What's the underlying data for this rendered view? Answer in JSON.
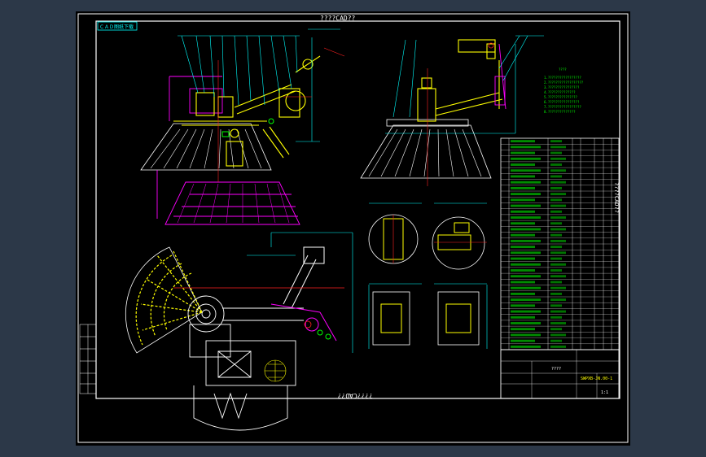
{
  "drawing": {
    "title_top": "????CAD??",
    "title_bottom": "????CAD??",
    "title_side": "????CAD??",
    "stamp": "ＣＡＤ图纸下载",
    "block_name": "????",
    "block_code": "SWPXB-JN.00-1",
    "block_scale": "1:1"
  },
  "colors": {
    "background": "#000000",
    "frame": "#ffffff",
    "magenta": "#ff00ff",
    "yellow": "#ffff00",
    "cyan": "#00ffff",
    "green": "#00ff00",
    "red": "#ff2020",
    "white": "#ffffff"
  }
}
